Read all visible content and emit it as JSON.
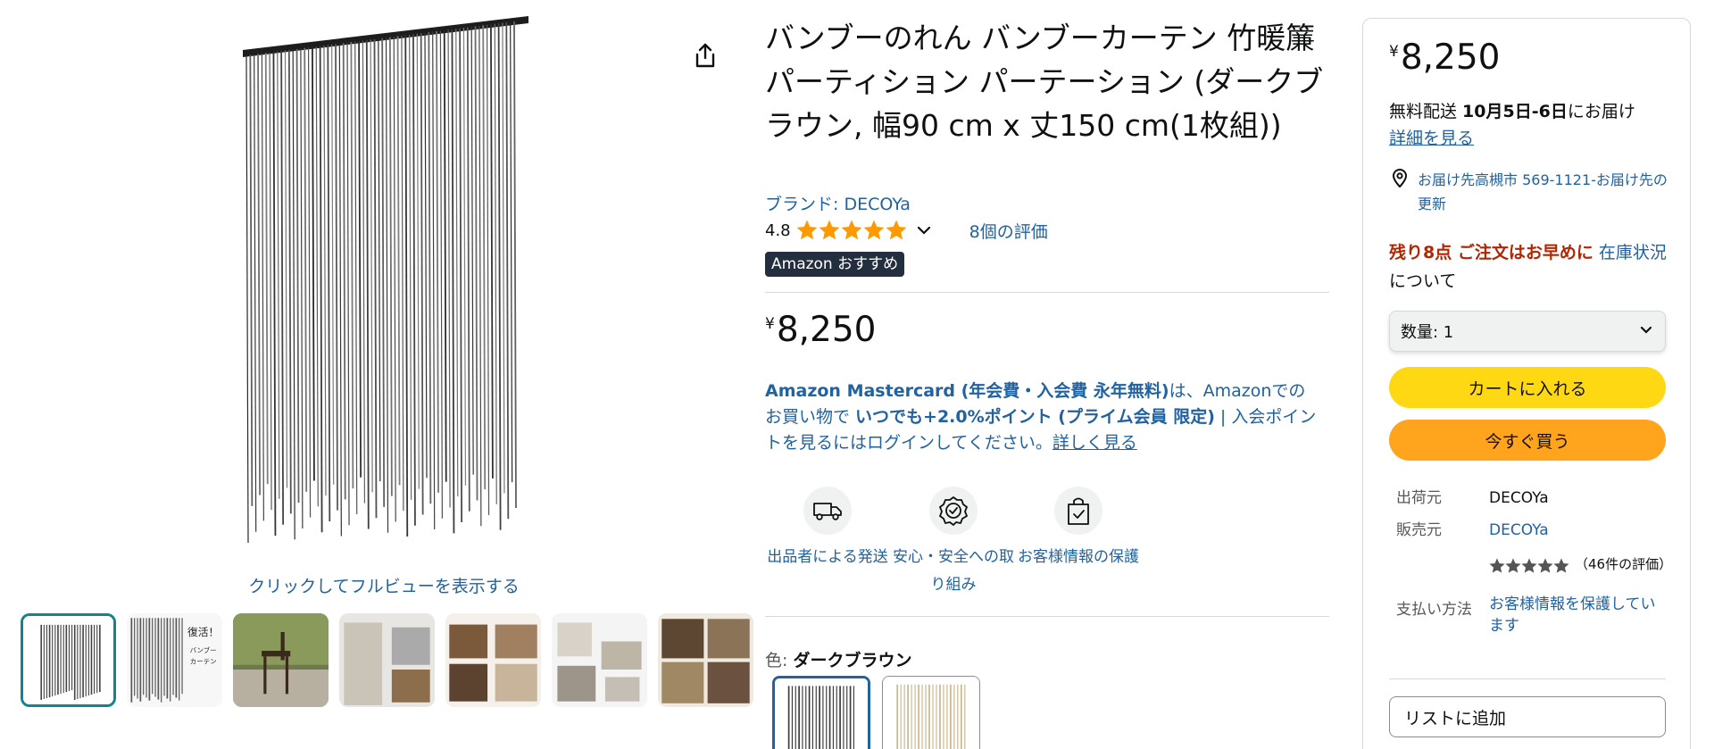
{
  "gallery": {
    "fullview_label": "クリックしてフルビューを表示する",
    "thumb_texts": {
      "t2_line1": "復活！",
      "t2_line2": "バンブー",
      "t2_line3": "カーテン"
    }
  },
  "product": {
    "title": "バンブーのれん バンブーカーテン 竹暖簾 パーティション パーテーション (ダークブラウン, 幅90 cm x 丈150 cm(1枚組))",
    "brand": "ブランド: DECOYa",
    "rating": "4.8",
    "rating_value": 4.8,
    "reviews": "8個の評価",
    "badge": "Amazon おすすめ",
    "price_symbol": "¥",
    "price": "8,250"
  },
  "promo": {
    "card_name": "Amazon Mastercard (年会費・入会費 永年無料)",
    "text1": "は、Amazonでのお買い物で ",
    "points": "いつでも+2.0%ポイント (プライム会員 限定)",
    "text2": " | 入会ポイントを見るにはログインしてください。",
    "more": "詳しく見る"
  },
  "features": [
    {
      "icon": "delivery-truck-icon",
      "label": "出品者による発送"
    },
    {
      "icon": "safety-badge-icon",
      "label": "安心・安全への取り組み"
    },
    {
      "icon": "secure-bag-icon",
      "label": "お客様情報の保護"
    }
  ],
  "variation": {
    "label": "色: ",
    "value": "ダークブラウン"
  },
  "buybox": {
    "price_symbol": "¥",
    "price": "8,250",
    "delivery_prefix": "無料配送 ",
    "delivery_date": "10月5日-6日",
    "delivery_suffix": "にお届け",
    "details_link": "詳細を見る",
    "location": "お届け先高槻市 569-1121-お届け先の更新",
    "stock_red": "残り8点 ご注文はお早めに",
    "stock_link": " 在庫状況",
    "stock_suffix": "について",
    "qty_label": "数量: 1",
    "add_to_cart": "カートに入れる",
    "buy_now": "今すぐ買う",
    "ship_from_label": "出荷元",
    "ship_from": "DECOYa",
    "seller_label": "販売元",
    "seller": "DECOYa",
    "seller_rating_count": "（46件の評価）",
    "payment_label": "支払い方法",
    "payment": "お客様情報を保護しています",
    "add_to_list": "リストに追加"
  },
  "colors": {
    "link": "#2162a1",
    "star": "#ff9900",
    "cart": "#ffd814",
    "buy": "#ffa41c",
    "badge_bg": "#232f3e",
    "alert": "#b12704"
  }
}
